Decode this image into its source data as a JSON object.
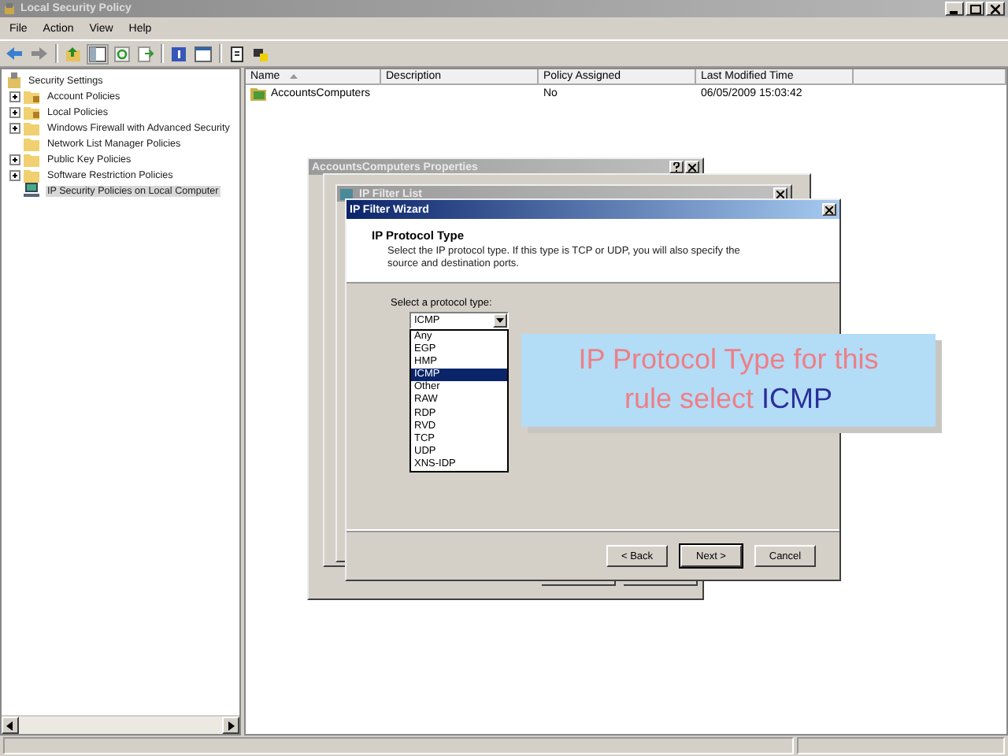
{
  "window": {
    "title": "Local Security Policy"
  },
  "menu": [
    "File",
    "Action",
    "View",
    "Help"
  ],
  "tree": {
    "label": "Security Settings",
    "children": [
      {
        "label": "Account Policies",
        "expandable": true,
        "selected": false,
        "kind": "locked"
      },
      {
        "label": "Local Policies",
        "expandable": true,
        "selected": false,
        "kind": "locked"
      },
      {
        "label": "Windows Firewall with Advanced Security",
        "expandable": true,
        "selected": false,
        "kind": "folder"
      },
      {
        "label": "Network List Manager Policies",
        "expandable": false,
        "selected": false,
        "kind": "folder"
      },
      {
        "label": "Public Key Policies",
        "expandable": true,
        "selected": false,
        "kind": "folder"
      },
      {
        "label": "Software Restriction Policies",
        "expandable": true,
        "selected": false,
        "kind": "folder"
      },
      {
        "label": "IP Security Policies on Local Computer",
        "expandable": false,
        "selected": true,
        "kind": "computer"
      }
    ]
  },
  "table": {
    "columns": [
      "Name",
      "Description",
      "Policy Assigned",
      "Last Modified Time"
    ],
    "rows": [
      {
        "name": "AccountsComputers",
        "policy_assigned": "No",
        "last_modified": "06/05/2009 15:03:42"
      }
    ]
  },
  "dialogs": [
    {
      "title": "AccountsComputers Properties"
    },
    {
      "title": "IP Filter List"
    }
  ],
  "wizard": {
    "title": "IP Filter Wizard",
    "heading": "IP Protocol Type",
    "description": "Select the IP protocol type. If this type is TCP or UDP, you will also specify the source and destination ports.",
    "field_label": "Select a protocol type:",
    "combo_value": "ICMP",
    "options": [
      {
        "label": "Any",
        "selected": false
      },
      {
        "label": "EGP",
        "selected": false
      },
      {
        "label": "HMP",
        "selected": false
      },
      {
        "label": "ICMP",
        "selected": true
      },
      {
        "label": "Other",
        "selected": false
      },
      {
        "label": "RAW",
        "selected": false
      },
      {
        "label": "RDP",
        "selected": false
      },
      {
        "label": "RVD",
        "selected": false
      },
      {
        "label": "TCP",
        "selected": false
      },
      {
        "label": "UDP",
        "selected": false
      },
      {
        "label": "XNS-IDP",
        "selected": false
      }
    ],
    "buttons": [
      {
        "label": "< Back",
        "default": false
      },
      {
        "label": "Next >",
        "default": true
      },
      {
        "label": "Cancel",
        "default": false
      }
    ]
  },
  "callout": {
    "lines": [
      "IP Protocol Type for this",
      "rule select"
    ],
    "highlight": "ICMP"
  }
}
